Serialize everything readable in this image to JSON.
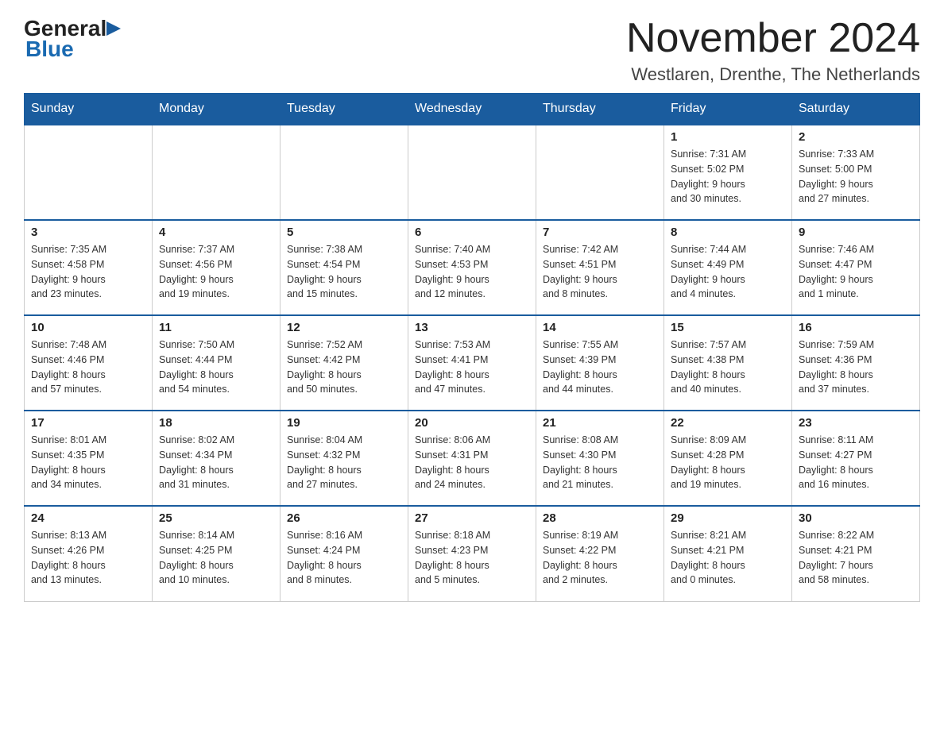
{
  "header": {
    "logo": {
      "general": "General",
      "blue": "Blue"
    },
    "month_year": "November 2024",
    "location": "Westlaren, Drenthe, The Netherlands"
  },
  "calendar": {
    "days_of_week": [
      "Sunday",
      "Monday",
      "Tuesday",
      "Wednesday",
      "Thursday",
      "Friday",
      "Saturday"
    ],
    "weeks": [
      [
        {
          "day": "",
          "info": ""
        },
        {
          "day": "",
          "info": ""
        },
        {
          "day": "",
          "info": ""
        },
        {
          "day": "",
          "info": ""
        },
        {
          "day": "",
          "info": ""
        },
        {
          "day": "1",
          "info": "Sunrise: 7:31 AM\nSunset: 5:02 PM\nDaylight: 9 hours\nand 30 minutes."
        },
        {
          "day": "2",
          "info": "Sunrise: 7:33 AM\nSunset: 5:00 PM\nDaylight: 9 hours\nand 27 minutes."
        }
      ],
      [
        {
          "day": "3",
          "info": "Sunrise: 7:35 AM\nSunset: 4:58 PM\nDaylight: 9 hours\nand 23 minutes."
        },
        {
          "day": "4",
          "info": "Sunrise: 7:37 AM\nSunset: 4:56 PM\nDaylight: 9 hours\nand 19 minutes."
        },
        {
          "day": "5",
          "info": "Sunrise: 7:38 AM\nSunset: 4:54 PM\nDaylight: 9 hours\nand 15 minutes."
        },
        {
          "day": "6",
          "info": "Sunrise: 7:40 AM\nSunset: 4:53 PM\nDaylight: 9 hours\nand 12 minutes."
        },
        {
          "day": "7",
          "info": "Sunrise: 7:42 AM\nSunset: 4:51 PM\nDaylight: 9 hours\nand 8 minutes."
        },
        {
          "day": "8",
          "info": "Sunrise: 7:44 AM\nSunset: 4:49 PM\nDaylight: 9 hours\nand 4 minutes."
        },
        {
          "day": "9",
          "info": "Sunrise: 7:46 AM\nSunset: 4:47 PM\nDaylight: 9 hours\nand 1 minute."
        }
      ],
      [
        {
          "day": "10",
          "info": "Sunrise: 7:48 AM\nSunset: 4:46 PM\nDaylight: 8 hours\nand 57 minutes."
        },
        {
          "day": "11",
          "info": "Sunrise: 7:50 AM\nSunset: 4:44 PM\nDaylight: 8 hours\nand 54 minutes."
        },
        {
          "day": "12",
          "info": "Sunrise: 7:52 AM\nSunset: 4:42 PM\nDaylight: 8 hours\nand 50 minutes."
        },
        {
          "day": "13",
          "info": "Sunrise: 7:53 AM\nSunset: 4:41 PM\nDaylight: 8 hours\nand 47 minutes."
        },
        {
          "day": "14",
          "info": "Sunrise: 7:55 AM\nSunset: 4:39 PM\nDaylight: 8 hours\nand 44 minutes."
        },
        {
          "day": "15",
          "info": "Sunrise: 7:57 AM\nSunset: 4:38 PM\nDaylight: 8 hours\nand 40 minutes."
        },
        {
          "day": "16",
          "info": "Sunrise: 7:59 AM\nSunset: 4:36 PM\nDaylight: 8 hours\nand 37 minutes."
        }
      ],
      [
        {
          "day": "17",
          "info": "Sunrise: 8:01 AM\nSunset: 4:35 PM\nDaylight: 8 hours\nand 34 minutes."
        },
        {
          "day": "18",
          "info": "Sunrise: 8:02 AM\nSunset: 4:34 PM\nDaylight: 8 hours\nand 31 minutes."
        },
        {
          "day": "19",
          "info": "Sunrise: 8:04 AM\nSunset: 4:32 PM\nDaylight: 8 hours\nand 27 minutes."
        },
        {
          "day": "20",
          "info": "Sunrise: 8:06 AM\nSunset: 4:31 PM\nDaylight: 8 hours\nand 24 minutes."
        },
        {
          "day": "21",
          "info": "Sunrise: 8:08 AM\nSunset: 4:30 PM\nDaylight: 8 hours\nand 21 minutes."
        },
        {
          "day": "22",
          "info": "Sunrise: 8:09 AM\nSunset: 4:28 PM\nDaylight: 8 hours\nand 19 minutes."
        },
        {
          "day": "23",
          "info": "Sunrise: 8:11 AM\nSunset: 4:27 PM\nDaylight: 8 hours\nand 16 minutes."
        }
      ],
      [
        {
          "day": "24",
          "info": "Sunrise: 8:13 AM\nSunset: 4:26 PM\nDaylight: 8 hours\nand 13 minutes."
        },
        {
          "day": "25",
          "info": "Sunrise: 8:14 AM\nSunset: 4:25 PM\nDaylight: 8 hours\nand 10 minutes."
        },
        {
          "day": "26",
          "info": "Sunrise: 8:16 AM\nSunset: 4:24 PM\nDaylight: 8 hours\nand 8 minutes."
        },
        {
          "day": "27",
          "info": "Sunrise: 8:18 AM\nSunset: 4:23 PM\nDaylight: 8 hours\nand 5 minutes."
        },
        {
          "day": "28",
          "info": "Sunrise: 8:19 AM\nSunset: 4:22 PM\nDaylight: 8 hours\nand 2 minutes."
        },
        {
          "day": "29",
          "info": "Sunrise: 8:21 AM\nSunset: 4:21 PM\nDaylight: 8 hours\nand 0 minutes."
        },
        {
          "day": "30",
          "info": "Sunrise: 8:22 AM\nSunset: 4:21 PM\nDaylight: 7 hours\nand 58 minutes."
        }
      ]
    ]
  }
}
